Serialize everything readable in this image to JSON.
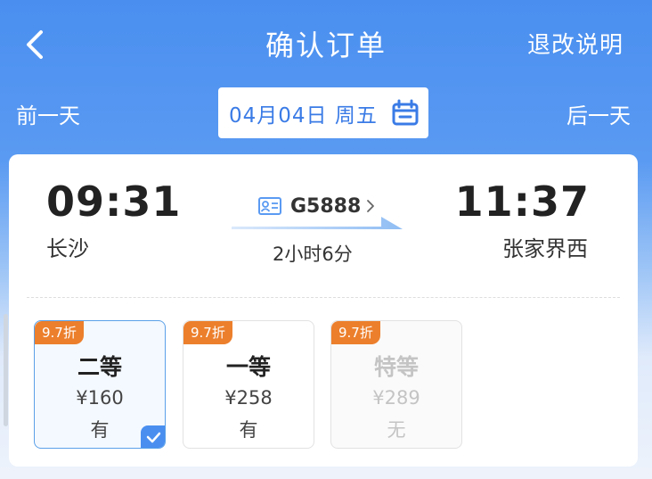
{
  "header": {
    "title": "确认订单",
    "refund_link": "退改说明"
  },
  "day_bar": {
    "prev_label": "前一天",
    "next_label": "后一天",
    "date_text": "04月04日 周五"
  },
  "trip": {
    "departure_time": "09:31",
    "departure_station": "长沙",
    "arrival_time": "11:37",
    "arrival_station": "张家界西",
    "train_number": "G5888",
    "duration": "2小时6分"
  },
  "seats": [
    {
      "discount": "9.7折",
      "name": "二等",
      "price": "¥160",
      "availability": "有",
      "selected": true,
      "disabled": false
    },
    {
      "discount": "9.7折",
      "name": "一等",
      "price": "¥258",
      "availability": "有",
      "selected": false,
      "disabled": false
    },
    {
      "discount": "9.7折",
      "name": "特等",
      "price": "¥289",
      "availability": "无",
      "selected": false,
      "disabled": true
    }
  ],
  "colors": {
    "brand_blue": "#4a8ff0",
    "discount_orange": "#ec7f2c"
  },
  "icons": {
    "back": "chevron-left-icon",
    "calendar": "calendar-icon",
    "train_id": "id-card-icon",
    "train_detail": "chevron-right-icon",
    "selected": "check-icon"
  }
}
